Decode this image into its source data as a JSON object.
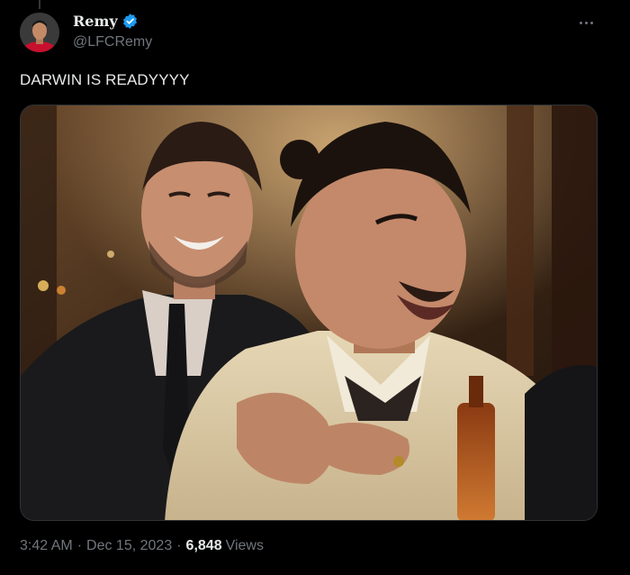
{
  "author": {
    "display_name": "Remy",
    "handle": "@LFCRemy",
    "verified_icon": "verified-badge-icon"
  },
  "tweet": {
    "text": "DARWIN IS READYYYY"
  },
  "meta": {
    "time": "3:42 AM",
    "separator": "·",
    "date": "Dec 15, 2023",
    "views_count": "6,848",
    "views_label": "Views"
  },
  "colors": {
    "background": "#000000",
    "text": "#e7e9ea",
    "secondary": "#71767b",
    "verified": "#1d9bf0"
  }
}
